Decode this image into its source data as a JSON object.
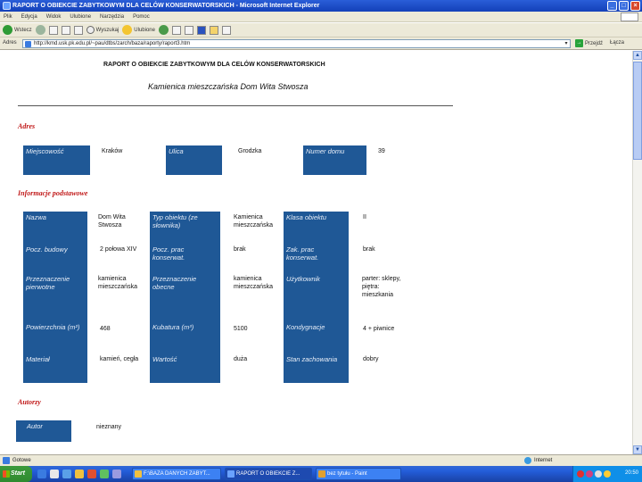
{
  "window": {
    "title": "RAPORT O OBIEKCIE ZABYTKOWYM DLA CELÓW KONSERWATORSKICH - Microsoft Internet Explorer",
    "buttons": [
      "_",
      "□",
      "×"
    ]
  },
  "menu": [
    "Plik",
    "Edycja",
    "Widok",
    "Ulubione",
    "Narzędzia",
    "Pomoc"
  ],
  "toolbar": {
    "back_label": "Wstecz",
    "search_label": "Wyszukaj",
    "favorites_label": "Ulubione"
  },
  "address": {
    "label": "Adres",
    "url": "http://kmd.usk.pk.edu.pl/~pau/dtbs/zarch/baza/raporty/raport3.htm",
    "go_label": "Przejdź",
    "links_label": "Łącza"
  },
  "report": {
    "title": "RAPORT O OBIEKCIE ZABYTKOWYM DLA CELÓW KONSERWATORSKICH",
    "subtitle": "Kamienica mieszczańska Dom Wita Stwosza",
    "sections": {
      "address": "Adres",
      "basic": "Informacje podstawowe",
      "authors": "Autorzy"
    },
    "address_fields": {
      "city_label": "Miejscowość",
      "city_value": "Kraków",
      "street_label": "Ulica",
      "street_value": "Grodzka",
      "number_label": "Numer domu",
      "number_value": "39"
    },
    "basic_rows": [
      {
        "l1": "Nazwa",
        "v1": "Dom Wita Stwosza",
        "l2": "Typ obiektu (ze słownika)",
        "v2": "Kamienica mieszczańska",
        "l3": "Klasa obiektu",
        "v3": "II"
      },
      {
        "l1": "Pocz. budowy",
        "v1": "2 połowa XIV",
        "l2": "Pocz. prac konserwat.",
        "v2": "brak",
        "l3": "Zak. prac konserwat.",
        "v3": "brak"
      },
      {
        "l1": "Przeznaczenie pierwotne",
        "v1": "kamienica mieszczańska",
        "l2": "Przeznaczenie obecne",
        "v2": "kamienica mieszczańska",
        "l3": "Użytkownik",
        "v3": "parter: sklepy, piętra: mieszkania"
      },
      {
        "l1": "Powierzchnia (m²)",
        "v1": "468",
        "l2": "Kubatura (m³)",
        "v2": "5100",
        "l3": "Kondygnacje",
        "v3": "4 + piwnice"
      },
      {
        "l1": "Materiał",
        "v1": "kamień, cegła",
        "l2": "Wartość",
        "v2": "duża",
        "l3": "Stan zachowania",
        "v3": "dobry"
      }
    ],
    "author_label": "Autor",
    "author_value": "nieznany"
  },
  "status": {
    "text": "Gotowe",
    "zone": "Internet"
  },
  "taskbar": {
    "start": "Start",
    "tasks": [
      "F:\\BAZA DANYCH ZABYT...",
      "RAPORT O OBIEKCIE Z...",
      "bez tytułu - Paint"
    ],
    "clock": "20:50"
  }
}
